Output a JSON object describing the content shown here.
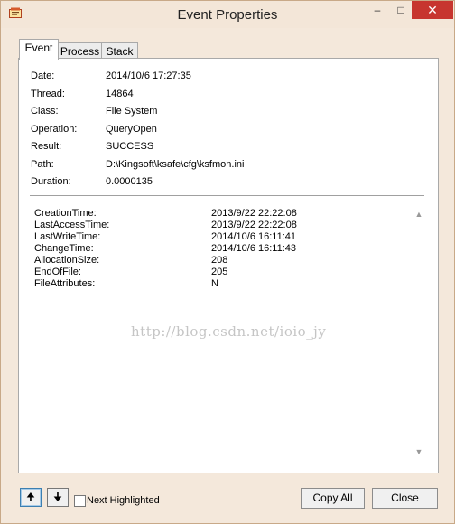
{
  "window": {
    "title": "Event Properties"
  },
  "title_controls": {
    "minimize": "–",
    "maximize": "□",
    "close": "✕"
  },
  "tabs": [
    {
      "label": "Event",
      "active": true
    },
    {
      "label": "Process",
      "active": false
    },
    {
      "label": "Stack",
      "active": false
    }
  ],
  "properties": [
    {
      "label": "Date:",
      "value": "2014/10/6 17:27:35"
    },
    {
      "label": "Thread:",
      "value": "14864"
    },
    {
      "label": "Class:",
      "value": "File System"
    },
    {
      "label": "Operation:",
      "value": "QueryOpen"
    },
    {
      "label": "Result:",
      "value": "SUCCESS"
    },
    {
      "label": "Path:",
      "value": "D:\\Kingsoft\\ksafe\\cfg\\ksfmon.ini"
    },
    {
      "label": "Duration:",
      "value": "0.0000135"
    }
  ],
  "details": [
    {
      "label": "CreationTime:",
      "value": "2013/9/22 22:22:08"
    },
    {
      "label": "LastAccessTime:",
      "value": "2013/9/22 22:22:08"
    },
    {
      "label": "LastWriteTime:",
      "value": "2014/10/6 16:11:41"
    },
    {
      "label": "ChangeTime:",
      "value": "2014/10/6 16:11:43"
    },
    {
      "label": "AllocationSize:",
      "value": "208"
    },
    {
      "label": "EndOfFile:",
      "value": "205"
    },
    {
      "label": "FileAttributes:",
      "value": "N"
    }
  ],
  "watermark": "http://blog.csdn.net/ioio_jy",
  "footer": {
    "up_arrow": "🠉",
    "down_arrow": "🠋",
    "next_highlighted": "Next Highlighted",
    "copy_all": "Copy All",
    "close": "Close"
  }
}
